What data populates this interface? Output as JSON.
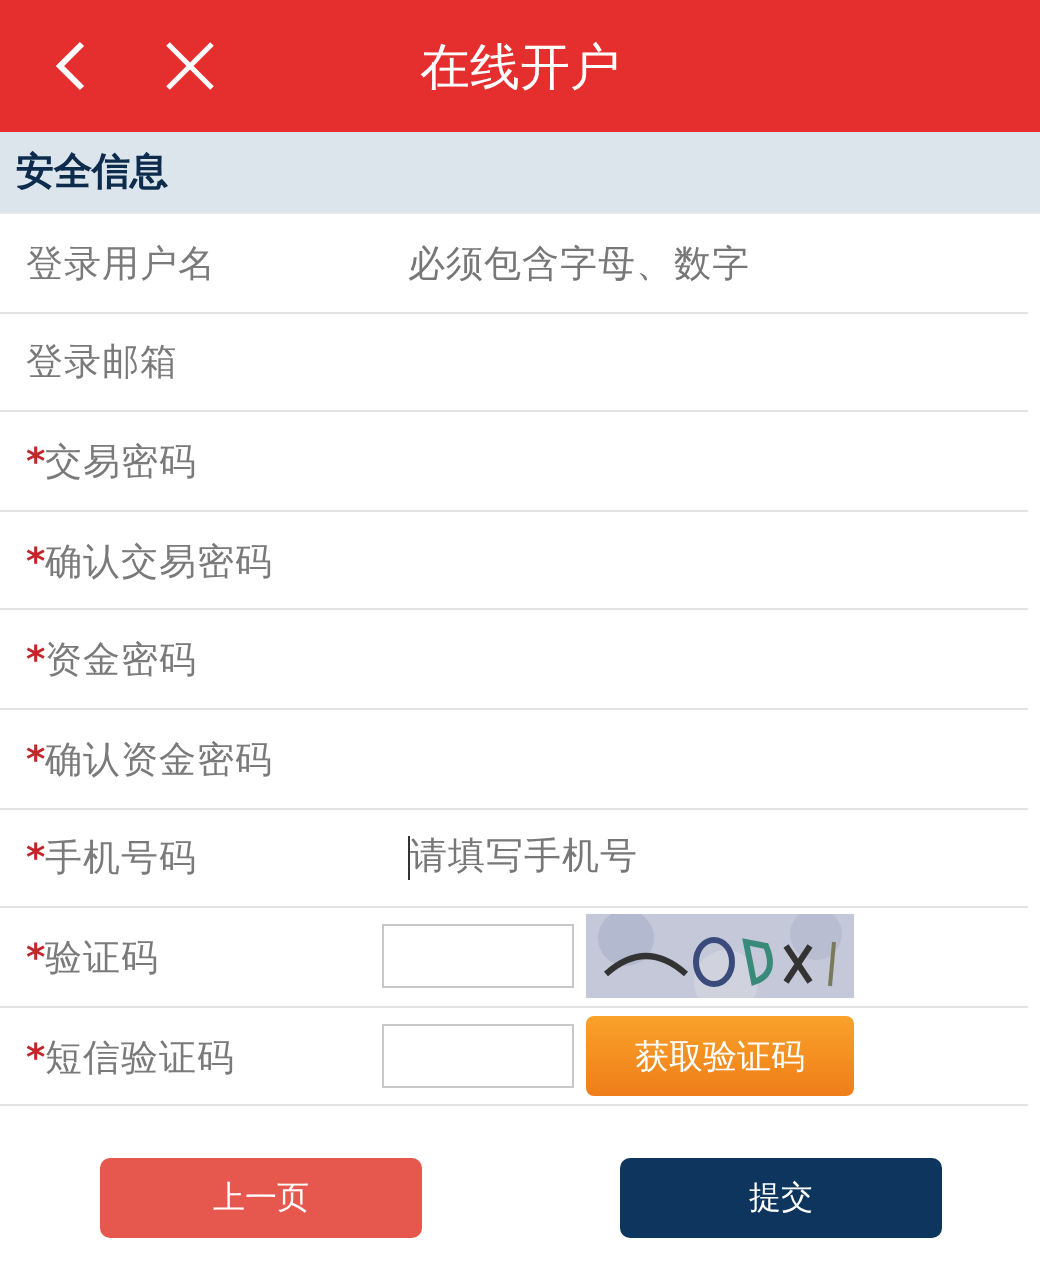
{
  "header": {
    "title": "在线开户"
  },
  "section": {
    "title": "安全信息"
  },
  "fields": [
    {
      "kind": "text",
      "label": "登录用户名",
      "placeholder": "必须包含字母、数字",
      "focused": false
    },
    {
      "kind": "text",
      "label": "登录邮箱"
    },
    {
      "kind": "text",
      "mark": "*",
      "label": "交易密码"
    },
    {
      "kind": "text",
      "mark": "*",
      "label": "确认交易密码"
    },
    {
      "kind": "text",
      "mark": "*",
      "label": "资金密码"
    },
    {
      "kind": "text",
      "mark": "*",
      "label": "确认资金密码"
    },
    {
      "kind": "text",
      "mark": "*",
      "label": "手机号码",
      "placeholder": "请填写手机号",
      "focused": true
    },
    {
      "kind": "captcha",
      "mark": "*",
      "label": "验证码"
    },
    {
      "kind": "sms",
      "mark": "*",
      "label": "短信验证码",
      "button": "获取验证码"
    }
  ],
  "buttons": [
    {
      "kind": "back",
      "label": "上一页"
    },
    {
      "kind": "submit",
      "label": "提交"
    }
  ]
}
